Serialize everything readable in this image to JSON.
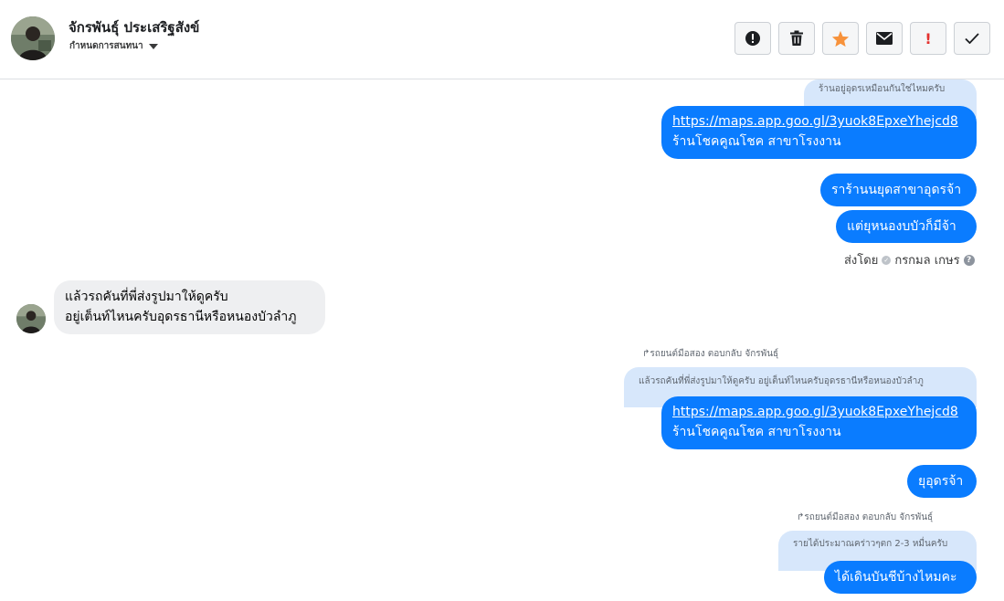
{
  "header": {
    "contact_name": "จักรพันธุ์ ประเสริฐสังข์",
    "subtitle": "กำหนดการสนทนา",
    "toolbar": {
      "icons": [
        "alert-icon",
        "trash-icon",
        "star-icon",
        "envelope-icon",
        "exclamation-icon",
        "check-icon"
      ],
      "exclamation_glyph": "!",
      "star_color": "#f7923b"
    }
  },
  "colors": {
    "outgoing_bubble": "#0a7cff",
    "incoming_bubble": "#eeeff1",
    "quoted_bubble": "#d7e7fb"
  },
  "messages": {
    "quote_1": "ร้านอยู่อุดรเหมือนกันใช่ไหมครับ",
    "out_1_link": "https://maps.app.goo.gl/3yuok8EpxeYhejcd8",
    "out_1_text": "ร้านโชคคูณโชค สาขาโรงงาน",
    "out_2": "ราร้านนยุดสาขาอุดรจ้า",
    "out_3": "แต่ยุหนองบบัวก็มีจ้า",
    "sent_by_label": "ส่งโดย",
    "sent_by_name": "กรกมล เกษร",
    "in_1_line1": "แล้วรถคันที่พี่ส่งรูปมาให้ดูครับ",
    "in_1_line2": "อยู่เต็นท์ไหนครับอุดรธานีหรือหนองบัวลำภู",
    "reply_note_1": "รถยนต์มือสอง ตอบกลับ จักรพันธุ์",
    "quote_2": "แล้วรถคันที่พี่ส่งรูปมาให้ดูครับ อยู่เต็นท์ไหนครับอุดรธานีหรือหนองบัวลำภู",
    "out_4_link": "https://maps.app.goo.gl/3yuok8EpxeYhejcd8",
    "out_4_text": "ร้านโชคคูณโชค สาขาโรงงาน",
    "out_5": "ยุอุดรจ้า",
    "reply_note_2": "รถยนต์มือสอง ตอบกลับ จักรพันธุ์",
    "quote_3": "รายได้ประมาณคร่าวๆตก 2-3 หมื่นครับ",
    "out_6": "ได้เดินบันชีบ้างไหมคะ"
  }
}
